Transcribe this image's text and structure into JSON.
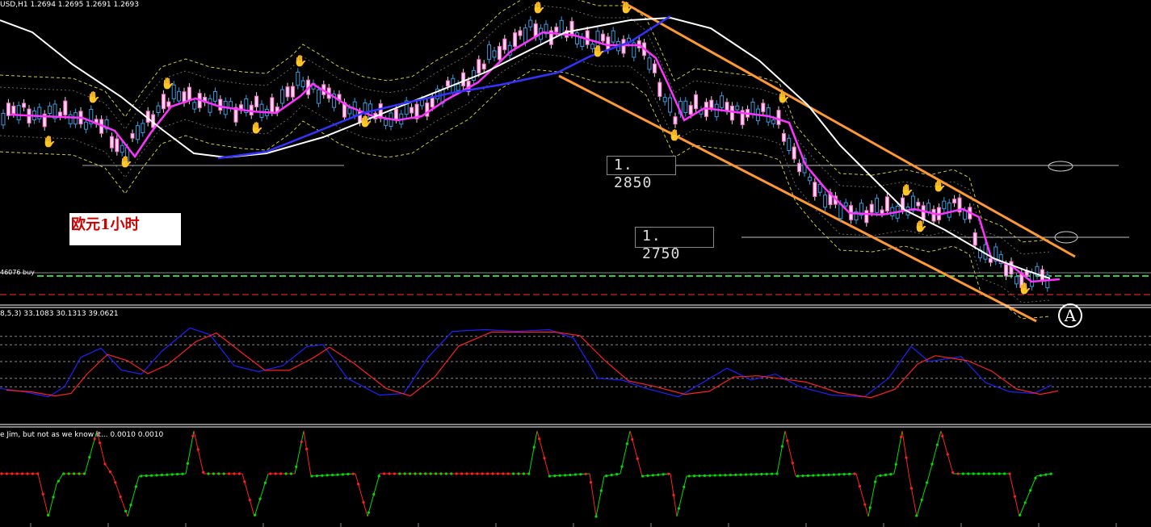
{
  "header": {
    "symbol_line": "USD,H1  1.2694 1.2695 1.2691 1.2693",
    "stoch_line": "8,5,3) 33.1083 30.1313 39.0621",
    "jim_line": "e Jim, but not as we know it...  0.0010 0.0010"
  },
  "annotations": {
    "note": "欧元1小时",
    "order_label": "46076 buy",
    "marker": "A"
  },
  "chart_data": [
    {
      "type": "candlestick",
      "panel": "price",
      "y_axis_visible": false,
      "levels": [
        {
          "value": "1.2850",
          "label": "1. 2850",
          "color": "#bfbfbf"
        },
        {
          "value": "1.2750",
          "label": "1. 2750",
          "color": "#bfbfbf"
        }
      ],
      "order_line": {
        "text": "46076 buy",
        "color": "#33cc33",
        "style": "dashed"
      },
      "channel": {
        "color": "#ff9933",
        "lines": 2,
        "direction": "down"
      },
      "indicators": [
        {
          "name": "fast MA",
          "color": "#ff33ff"
        },
        {
          "name": "slow MA",
          "color": "#ffffff"
        },
        {
          "name": "trend MA",
          "color": "#3333ff"
        },
        {
          "name": "envelope",
          "color": "#cccc33",
          "style": "dashed"
        }
      ]
    },
    {
      "type": "line",
      "panel": "stochastic",
      "params": "8,5,3",
      "values_shown": [
        33.1083,
        30.1313,
        39.0621
      ],
      "ylim": [
        0,
        100
      ],
      "levels": [
        20,
        30,
        50,
        70,
        80
      ],
      "series": [
        {
          "color": "#2020ff"
        },
        {
          "color": "#ff2020"
        }
      ]
    },
    {
      "type": "line",
      "panel": "jim",
      "values_shown": [
        0.001,
        0.001
      ],
      "colors": {
        "up": "#00dd00",
        "down": "#ff2020"
      }
    }
  ]
}
